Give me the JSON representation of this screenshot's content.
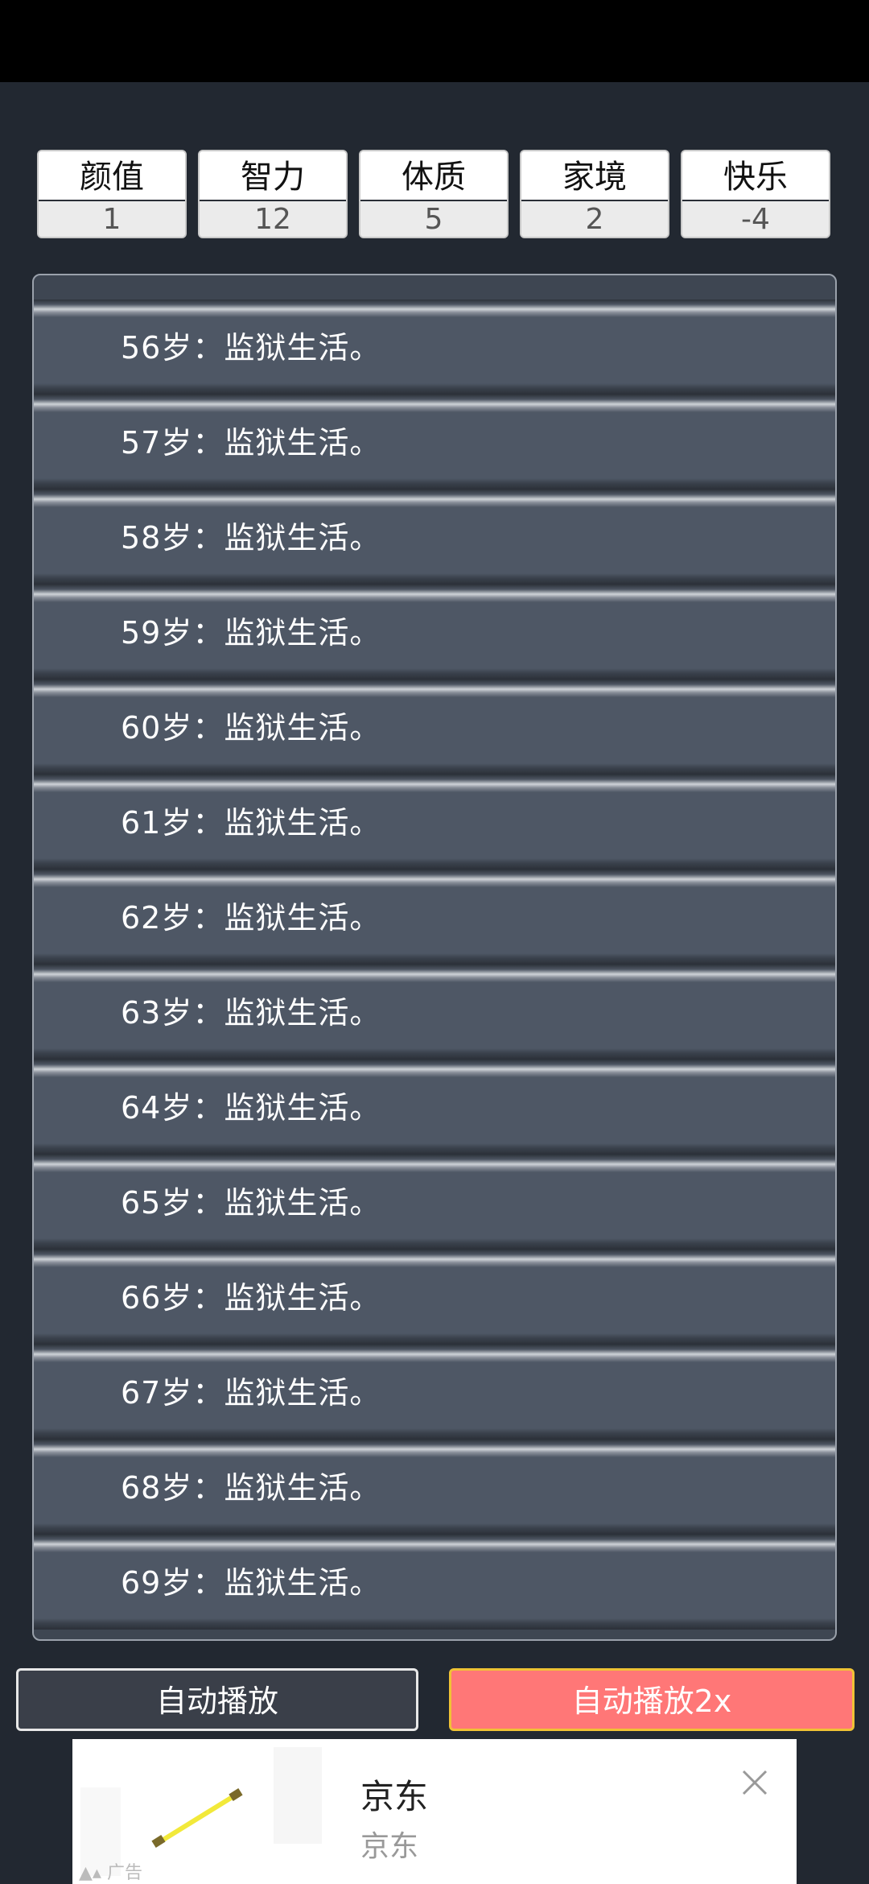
{
  "stats": [
    {
      "name": "颜值",
      "value": "1"
    },
    {
      "name": "智力",
      "value": "12"
    },
    {
      "name": "体质",
      "value": "5"
    },
    {
      "name": "家境",
      "value": "2"
    },
    {
      "name": "快乐",
      "value": "-4"
    }
  ],
  "log": [
    "56岁：监狱生活。",
    "57岁：监狱生活。",
    "58岁：监狱生活。",
    "59岁：监狱生活。",
    "60岁：监狱生活。",
    "61岁：监狱生活。",
    "62岁：监狱生活。",
    "63岁：监狱生活。",
    "64岁：监狱生活。",
    "65岁：监狱生活。",
    "66岁：监狱生活。",
    "67岁：监狱生活。",
    "68岁：监狱生活。",
    "69岁：监狱生活。"
  ],
  "buttons": {
    "auto_play": "自动播放",
    "auto_play_2x": "自动播放2x"
  },
  "ad": {
    "title": "京东",
    "subtitle": "京东",
    "label": "广告"
  },
  "colors": {
    "background": "#222831",
    "row": "#4e5765",
    "auto_2x_bg": "#ff7777",
    "auto_2x_border": "#f0c235"
  }
}
